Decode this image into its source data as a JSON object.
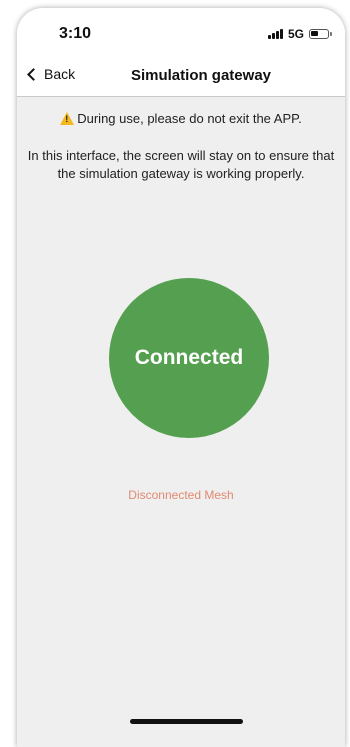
{
  "status_bar": {
    "time": "3:10",
    "network": "5G",
    "signal_icon": "signal-bars-icon",
    "battery_icon": "battery-icon"
  },
  "nav": {
    "back_label": "Back",
    "back_icon": "chevron-left-icon",
    "title": "Simulation gateway"
  },
  "content": {
    "warning_icon": "warning-triangle-icon",
    "warning_text": "During use, please do not exit the APP.",
    "info_text": "In this interface, the screen will stay on to ensure that the simulation gateway is working properly.",
    "status_label": "Connected",
    "mesh_status": "Disconnected Mesh"
  },
  "colors": {
    "status_circle": "#55a050",
    "mesh_status": "#e08a72",
    "background": "#efefef",
    "warning": "#f3b81d"
  }
}
